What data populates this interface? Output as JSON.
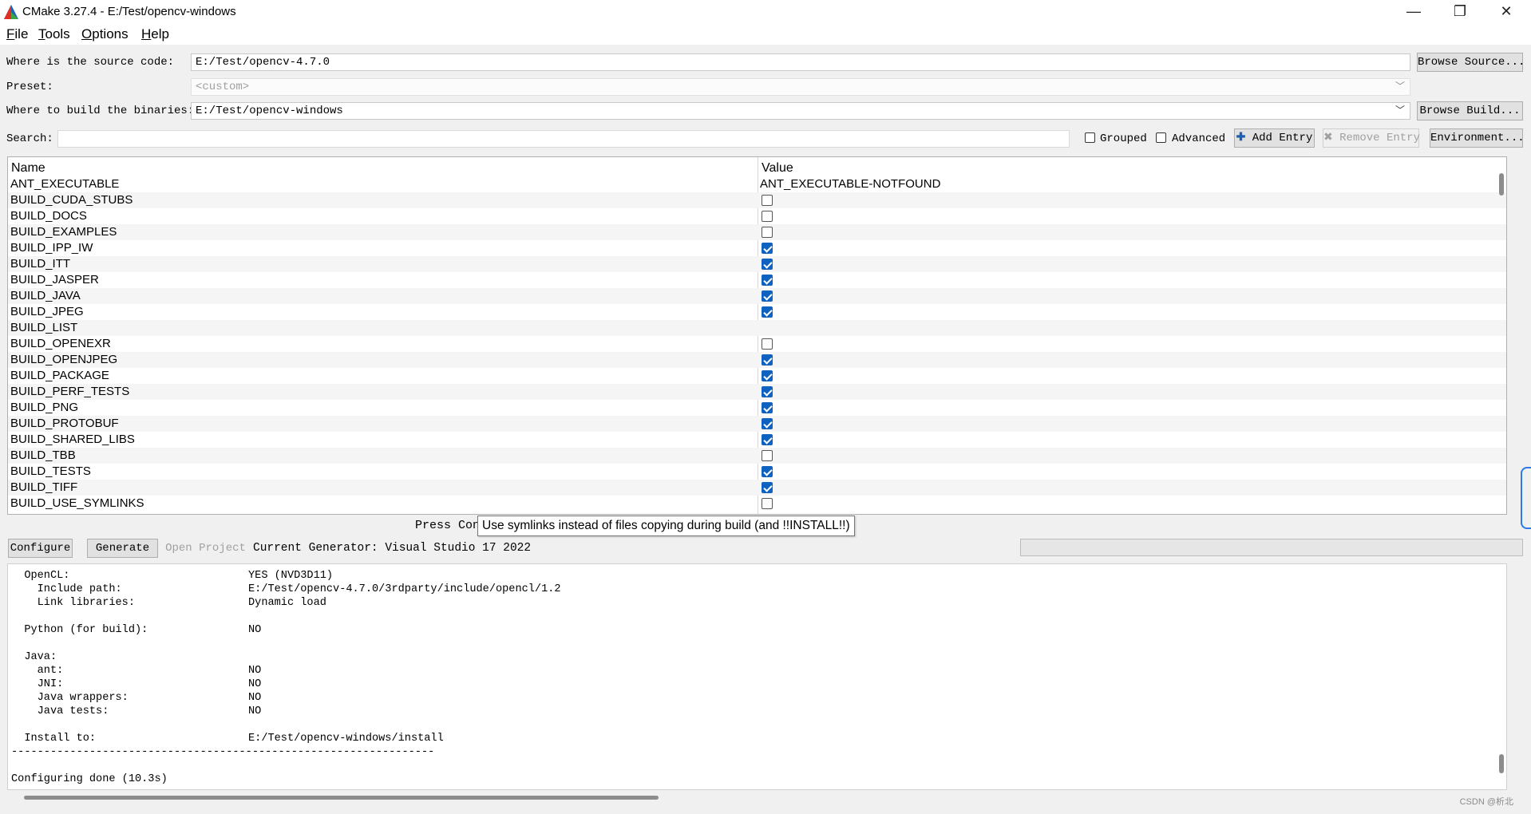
{
  "window": {
    "title": "CMake 3.27.4 - E:/Test/opencv-windows",
    "minimize_glyph": "—",
    "restore_glyph": "❐",
    "close_glyph": "✕"
  },
  "menu": [
    {
      "mnemonic": "F",
      "rest": "ile"
    },
    {
      "mnemonic": "T",
      "rest": "ools"
    },
    {
      "mnemonic": "O",
      "rest": "ptions"
    },
    {
      "mnemonic": "H",
      "rest": "elp"
    }
  ],
  "source": {
    "label": "Where is the source code:",
    "value": "E:/Test/opencv-4.7.0",
    "browse_label": "Browse Source..."
  },
  "preset": {
    "label": "Preset:",
    "value": "<custom>"
  },
  "binaries": {
    "label": "Where to build the binaries:",
    "value": "E:/Test/opencv-windows",
    "browse_label": "Browse Build..."
  },
  "search": {
    "label": "Search:",
    "value": "",
    "grouped_label": "Grouped",
    "grouped_checked": false,
    "advanced_label": "Advanced",
    "advanced_checked": false,
    "add_entry_label": "Add Entry",
    "remove_entry_label": "Remove Entry",
    "environment_label": "Environment..."
  },
  "table": {
    "headers": {
      "name": "Name",
      "value": "Value"
    },
    "rows": [
      {
        "name": "ANT_EXECUTABLE",
        "type": "text",
        "value": "ANT_EXECUTABLE-NOTFOUND"
      },
      {
        "name": "BUILD_CUDA_STUBS",
        "type": "bool",
        "value": false
      },
      {
        "name": "BUILD_DOCS",
        "type": "bool",
        "value": false
      },
      {
        "name": "BUILD_EXAMPLES",
        "type": "bool",
        "value": false
      },
      {
        "name": "BUILD_IPP_IW",
        "type": "bool",
        "value": true
      },
      {
        "name": "BUILD_ITT",
        "type": "bool",
        "value": true
      },
      {
        "name": "BUILD_JASPER",
        "type": "bool",
        "value": true
      },
      {
        "name": "BUILD_JAVA",
        "type": "bool",
        "value": true
      },
      {
        "name": "BUILD_JPEG",
        "type": "bool",
        "value": true
      },
      {
        "name": "BUILD_LIST",
        "type": "text",
        "value": ""
      },
      {
        "name": "BUILD_OPENEXR",
        "type": "bool",
        "value": false
      },
      {
        "name": "BUILD_OPENJPEG",
        "type": "bool",
        "value": true
      },
      {
        "name": "BUILD_PACKAGE",
        "type": "bool",
        "value": true
      },
      {
        "name": "BUILD_PERF_TESTS",
        "type": "bool",
        "value": true
      },
      {
        "name": "BUILD_PNG",
        "type": "bool",
        "value": true
      },
      {
        "name": "BUILD_PROTOBUF",
        "type": "bool",
        "value": true
      },
      {
        "name": "BUILD_SHARED_LIBS",
        "type": "bool",
        "value": true
      },
      {
        "name": "BUILD_TBB",
        "type": "bool",
        "value": false
      },
      {
        "name": "BUILD_TESTS",
        "type": "bool",
        "value": true
      },
      {
        "name": "BUILD_TIFF",
        "type": "bool",
        "value": true
      },
      {
        "name": "BUILD_USE_SYMLINKS",
        "type": "bool",
        "value": false
      }
    ]
  },
  "status": {
    "text": "Press Conf                                                         erate to generate selected build files.",
    "tooltip": "Use symlinks instead of files copying during build (and !!INSTALL!!)"
  },
  "actions": {
    "configure_label": "Configure",
    "generate_label": "Generate",
    "open_project_label": "Open Project",
    "current_generator": "Current Generator: Visual Studio 17 2022"
  },
  "output": {
    "lines": [
      {
        "text": "  OpenCL:",
        "value": "YES (NVD3D11)"
      },
      {
        "text": "    Include path:",
        "value": "E:/Test/opencv-4.7.0/3rdparty/include/opencl/1.2"
      },
      {
        "text": "    Link libraries:",
        "value": "Dynamic load"
      },
      {
        "text": "",
        "value": ""
      },
      {
        "text": "  Python (for build):",
        "value": "NO"
      },
      {
        "text": "",
        "value": ""
      },
      {
        "text": "  Java:",
        "value": ""
      },
      {
        "text": "    ant:",
        "value": "NO"
      },
      {
        "text": "    JNI:",
        "value": "NO"
      },
      {
        "text": "    Java wrappers:",
        "value": "NO"
      },
      {
        "text": "    Java tests:",
        "value": "NO"
      },
      {
        "text": "",
        "value": ""
      },
      {
        "text": "  Install to:",
        "value": "E:/Test/opencv-windows/install"
      },
      {
        "text": "-----------------------------------------------------------------",
        "value": ""
      },
      {
        "text": "",
        "value": ""
      },
      {
        "text": "Configuring done (10.3s)",
        "value": ""
      }
    ]
  },
  "watermark": "CSDN @析北",
  "colors": {
    "checkbox_on": "#0f62c0",
    "window_bg": "#f0f0f0",
    "highlight_handle": "#2c7be5"
  }
}
